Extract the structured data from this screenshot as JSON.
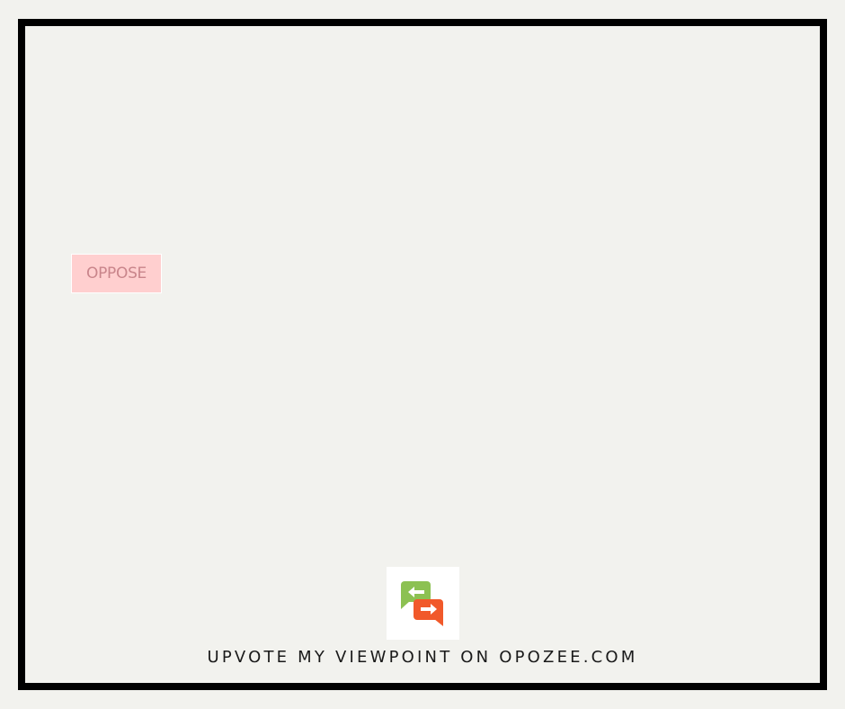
{
  "stance": {
    "label": "OPPOSE",
    "background_color": "#ffcfcf",
    "text_color": "#c9858b"
  },
  "logo": {
    "icon": "opozee-chat-bubbles-icon",
    "colors": {
      "left_bubble": "#8cc152",
      "right_bubble": "#f1592a"
    }
  },
  "footer": {
    "cta_text": "UPVOTE MY VIEWPOINT ON OPOZEE.COM"
  },
  "colors": {
    "background": "#f2f2ee",
    "frame_border": "#000000"
  }
}
